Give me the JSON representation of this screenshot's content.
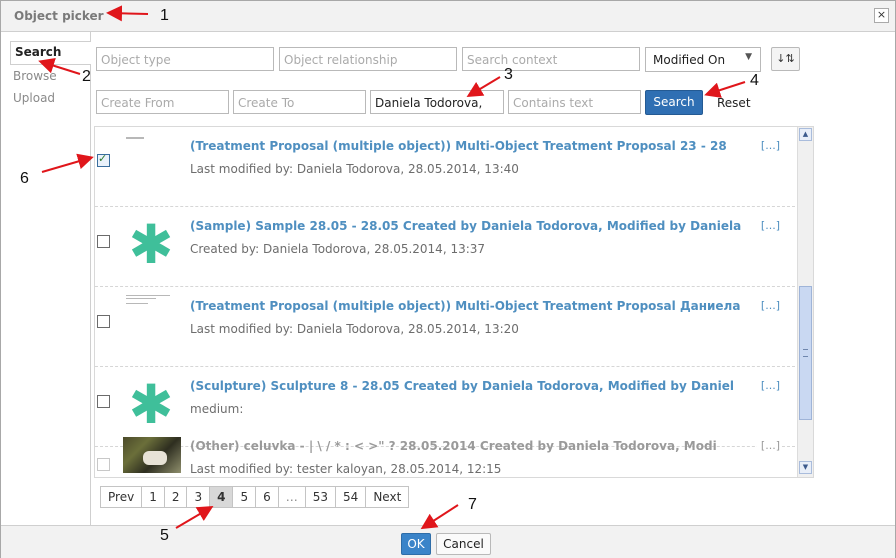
{
  "dialog": {
    "title": "Object picker",
    "close_icon": "×"
  },
  "sidebar": {
    "items": [
      {
        "label": "Search",
        "active": true
      },
      {
        "label": "Browse"
      },
      {
        "label": "Upload"
      }
    ]
  },
  "filters": {
    "object_type_placeholder": "Object type",
    "object_relationship_placeholder": "Object relationship",
    "search_context_placeholder": "Search context",
    "sort_value": "Modified On",
    "sort_arrow": "▼",
    "sort_toggle_icon": "↓⇅",
    "create_from_placeholder": "Create From",
    "create_to_placeholder": "Create To",
    "creator_value": "Daniela Todorova,",
    "contains_text_placeholder": "Contains text",
    "search_label": "Search",
    "reset_label": "Reset"
  },
  "results": [
    {
      "title": "(Treatment Proposal (multiple object)) Multi-Object Treatment Proposal 23 - 28",
      "more": "[...]",
      "sub": "Last modified by: Daniela Todorova, 28.05.2014, 13:40",
      "checked": true,
      "thumb": "document"
    },
    {
      "title": "(Sample) Sample 28.05 - 28.05 Created by Daniela Todorova, Modified by Daniela",
      "more": "[...]",
      "sub": "Created by: Daniela Todorova, 28.05.2014, 13:37",
      "checked": false,
      "thumb": "asterisk"
    },
    {
      "title": "(Treatment Proposal (multiple object)) Multi-Object Treatment Proposal Даниела",
      "more": "[...]",
      "sub": "Last modified by: Daniela Todorova, 28.05.2014, 13:20",
      "checked": false,
      "thumb": "document"
    },
    {
      "title": "(Sculpture) Sculpture 8 - 28.05 Created by Daniela Todorova, Modified by Daniel",
      "more": "[...]",
      "sub": "medium:",
      "checked": false,
      "thumb": "asterisk"
    },
    {
      "title": "(Other) celuvka - | \\ / * : < >\" ? 28.05.2014 Created by Daniela Todorova, Modi",
      "more": "[...]",
      "sub": "Last modified by: tester kaloyan, 28.05.2014, 12:15",
      "checked": false,
      "thumb": "photo"
    }
  ],
  "scroll": {
    "up_arrow": "▲",
    "down_arrow": "▼"
  },
  "pager": [
    "Prev",
    "1",
    "2",
    "3",
    "4",
    "5",
    "6",
    "…",
    "53",
    "54",
    "Next"
  ],
  "pager_active": "4",
  "footer": {
    "ok_label": "OK",
    "cancel_label": "Cancel"
  },
  "annotations": [
    "1",
    "2",
    "3",
    "4",
    "5",
    "6",
    "7"
  ],
  "colors": {
    "accent": "#2f6fb3",
    "title_link": "#4f8fc0",
    "annotation_arrow": "#e0161b"
  }
}
